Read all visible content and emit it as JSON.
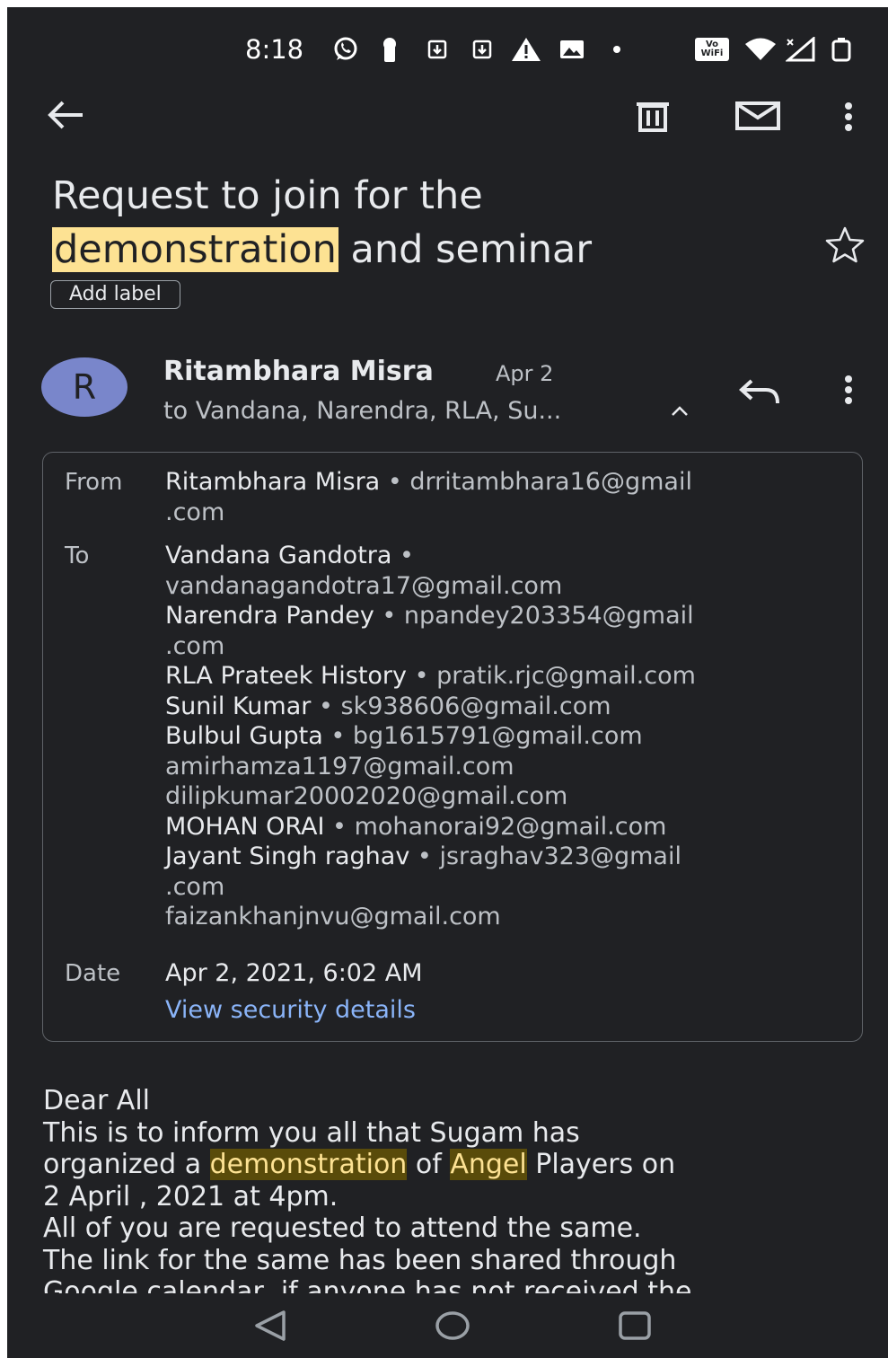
{
  "status_bar": {
    "time": "8:18",
    "icons": [
      "whatsapp-icon",
      "keyhole-icon",
      "download-box-icon",
      "download-box-icon",
      "warning-icon",
      "image-icon",
      "dot-icon",
      "vowifi-icon",
      "wifi-icon",
      "signal-icon",
      "battery-icon"
    ],
    "vowifi_top": "Vo",
    "vowifi_bottom": "WiFi"
  },
  "toolbar": {
    "back": "back-arrow-icon",
    "delete": "trash-icon",
    "mark_unread": "mail-icon",
    "more": "more-vert-icon"
  },
  "email": {
    "subject_part1": "Request to join for the",
    "subject_highlight": "demonstration",
    "subject_part2": "and seminar",
    "add_label": "Add label",
    "sender_initial": "R",
    "sender_name": "Ritambhara Misra",
    "date_short": "Apr 2",
    "recipients_summary": "to Vandana, Narendra, RLA, Su...",
    "details": {
      "from_label": "From",
      "from_name": "Ritambhara Misra",
      "from_email_l1": "drritambhara16@gmail",
      "from_email_l2": ".com",
      "to_label": "To",
      "to": {
        "r1_name": "Vandana Gandotra",
        "r1_email": "vandanagandotra17@gmail.com",
        "r2_name": "Narendra Pandey",
        "r2_email_l1": "npandey203354@gmail",
        "r2_email_l2": ".com",
        "r3_name": "RLA Prateek History",
        "r3_email": "pratik.rjc@gmail.com",
        "r4_name": "Sunil Kumar",
        "r4_email": "sk938606@gmail.com",
        "r5_name": "Bulbul Gupta",
        "r5_email": "bg1615791@gmail.com",
        "r6_email": "amirhamza1197@gmail.com",
        "r7_email": "dilipkumar20002020@gmail.com",
        "r8_name": "MOHAN ORAI",
        "r8_email": "mohanorai92@gmail.com",
        "r9_name": "Jayant Singh raghav",
        "r9_email_l1": "jsraghav323@gmail",
        "r9_email_l2": ".com",
        "r10_email": "faizankhanjnvu@gmail.com"
      },
      "separator": "•",
      "date_label": "Date",
      "date_full": "Apr 2, 2021, 6:02 AM",
      "security_link": "View security details"
    },
    "body": {
      "l1": "Dear All",
      "l2": "This is to inform you all that Sugam has",
      "l3_pre": "organized a ",
      "l3_hl1": "demonstration",
      "l3_mid": " of ",
      "l3_hl2": "Angel",
      "l3_post": " Players on",
      "l4": "2 April , 2021 at 4pm.",
      "l5": "All of you are requested to attend the same.",
      "l6": "The link for the same has been shared through",
      "l7": "Google calendar, if anyone has not received the"
    }
  },
  "nav": {
    "back": "nav-back-icon",
    "home": "nav-home-icon",
    "recents": "nav-recents-icon"
  }
}
